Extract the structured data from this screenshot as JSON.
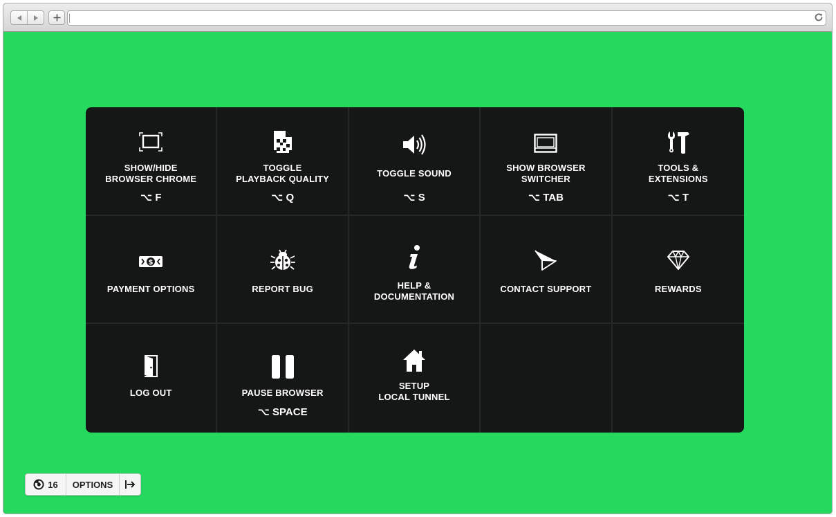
{
  "browser": {
    "back_icon": "triangle-left-icon",
    "forward_icon": "triangle-right-icon",
    "new_tab_icon": "plus-icon",
    "reload_icon": "reload-icon",
    "address_value": ""
  },
  "colors": {
    "background": "#24d95e",
    "panel": "#151716",
    "panel_divider": "#242826",
    "text": "#ffffff"
  },
  "menu": {
    "show_hide_chrome": {
      "label": "SHOW/HIDE\nBROWSER CHROME",
      "shortcut": "⌥ F",
      "icon": "fullscreen-frame-icon"
    },
    "playback_quality": {
      "label": "TOGGLE\nPLAYBACK QUALITY",
      "shortcut": "⌥ Q",
      "icon": "pixelated-file-icon"
    },
    "toggle_sound": {
      "label": "TOGGLE SOUND",
      "shortcut": "⌥ S",
      "icon": "speaker-icon"
    },
    "browser_switcher": {
      "label": "SHOW BROWSER\nSWITCHER",
      "shortcut": "⌥ TAB",
      "icon": "browser-window-icon"
    },
    "tools_extensions": {
      "label": "TOOLS &\nEXTENSIONS",
      "shortcut": "⌥ T",
      "icon": "wrench-hammer-icon"
    },
    "payment_options": {
      "label": "PAYMENT OPTIONS",
      "icon": "dollar-bill-icon"
    },
    "report_bug": {
      "label": "REPORT BUG",
      "icon": "ladybug-icon"
    },
    "help_docs": {
      "label": "HELP &\nDOCUMENTATION",
      "icon": "info-icon"
    },
    "contact_support": {
      "label": "CONTACT SUPPORT",
      "icon": "paper-plane-icon"
    },
    "rewards": {
      "label": "REWARDS",
      "icon": "diamond-icon"
    },
    "log_out": {
      "label": "LOG OUT",
      "icon": "door-exit-icon"
    },
    "pause_browser": {
      "label": "PAUSE BROWSER",
      "shortcut": "⌥ SPACE",
      "icon": "pause-icon"
    },
    "local_tunnel": {
      "label": "SETUP\nLOCAL TUNNEL",
      "icon": "home-icon"
    }
  },
  "bottom_bar": {
    "browser_icon": "firefox-icon",
    "browser_version": "16",
    "options_label": "OPTIONS",
    "exit_icon": "exit-arrow-icon"
  }
}
